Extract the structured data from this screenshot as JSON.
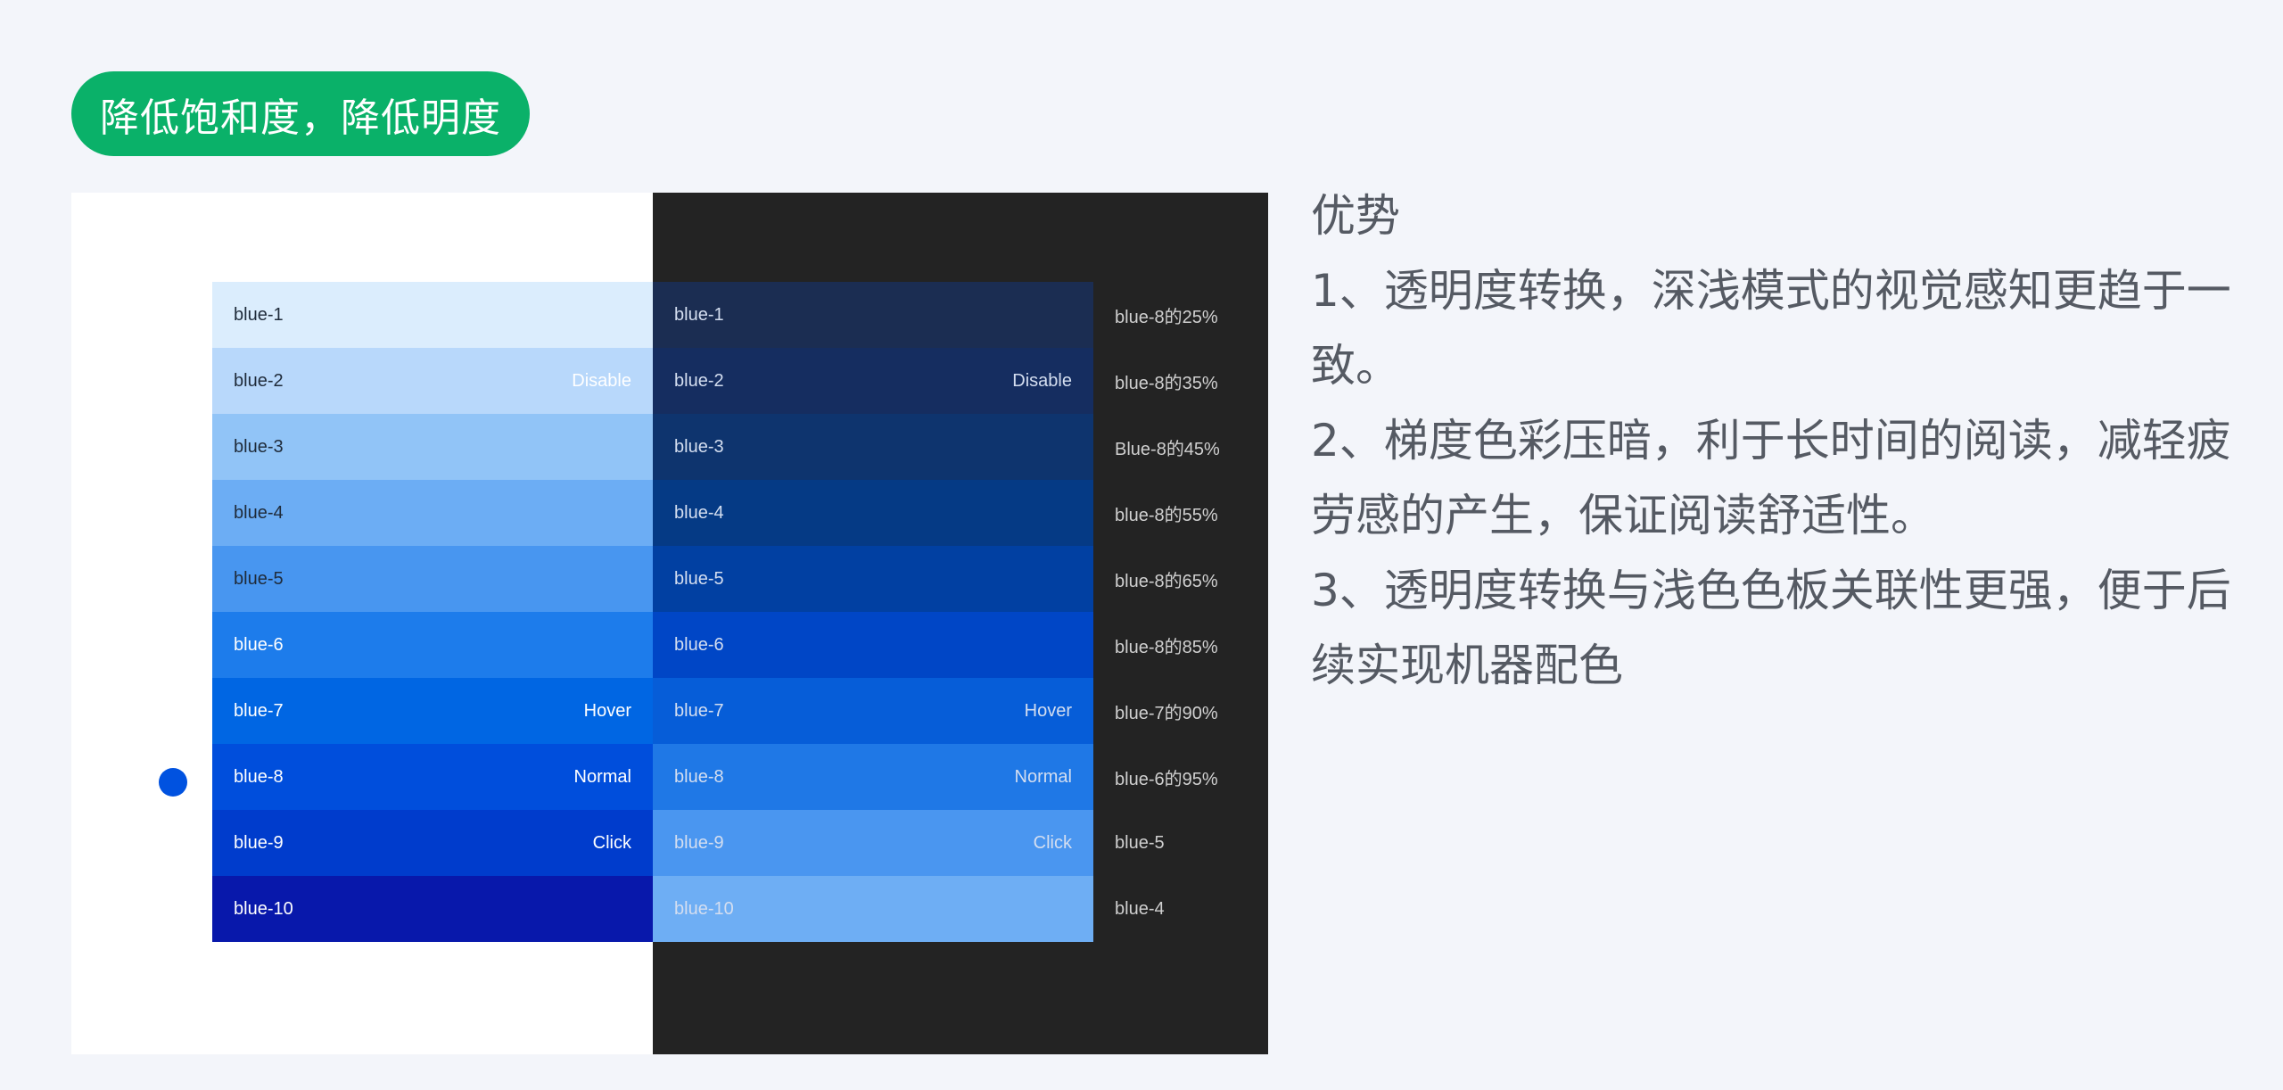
{
  "header": {
    "badge": "降低饱和度，降低明度"
  },
  "colors": {
    "badge_bg": "#0ab169",
    "badge_text": "#ffffff",
    "light_panel_bg": "#ffffff",
    "dark_panel_bg": "#232323",
    "marker": "#0052e0",
    "light_text_dark": "#1f2b3a",
    "light_text_light": "#ffffff",
    "dark_text": "#d4def0",
    "note_text": "#d0d0d0"
  },
  "light_palette": [
    {
      "name": "blue-1",
      "state": "",
      "color": "#dbedfd",
      "text": "dark"
    },
    {
      "name": "blue-2",
      "state": "Disable",
      "color": "#b8d8fb",
      "text": "dark",
      "state_text": "light"
    },
    {
      "name": "blue-3",
      "state": "",
      "color": "#91c4f7",
      "text": "dark"
    },
    {
      "name": "blue-4",
      "state": "",
      "color": "#6cadf4",
      "text": "dark"
    },
    {
      "name": "blue-5",
      "state": "",
      "color": "#4896f0",
      "text": "dark"
    },
    {
      "name": "blue-6",
      "state": "",
      "color": "#1d7ceb",
      "text": "light"
    },
    {
      "name": "blue-7",
      "state": "Hover",
      "color": "#0066e3",
      "text": "light"
    },
    {
      "name": "blue-8",
      "state": "Normal",
      "color": "#004edc",
      "text": "light"
    },
    {
      "name": "blue-9",
      "state": "Click",
      "color": "#003ccc",
      "text": "light"
    },
    {
      "name": "blue-10",
      "state": "",
      "color": "#0818ab",
      "text": "light"
    }
  ],
  "dark_palette": [
    {
      "name": "blue-1",
      "state": "",
      "color": "#1b2d52"
    },
    {
      "name": "blue-2",
      "state": "Disable",
      "color": "#152d60"
    },
    {
      "name": "blue-3",
      "state": "",
      "color": "#0e346e"
    },
    {
      "name": "blue-4",
      "state": "",
      "color": "#053a85"
    },
    {
      "name": "blue-5",
      "state": "",
      "color": "#0140a2"
    },
    {
      "name": "blue-6",
      "state": "",
      "color": "#0046c6"
    },
    {
      "name": "blue-7",
      "state": "Hover",
      "color": "#065dd8"
    },
    {
      "name": "blue-8",
      "state": "Normal",
      "color": "#1f78e6"
    },
    {
      "name": "blue-9",
      "state": "Click",
      "color": "#4a96f0"
    },
    {
      "name": "blue-10",
      "state": "",
      "color": "#6eaef4"
    }
  ],
  "dark_notes": [
    "blue-8的25%",
    "blue-8的35%",
    "Blue-8的45%",
    "blue-8的55%",
    "blue-8的65%",
    "blue-8的85%",
    "blue-7的90%",
    "blue-6的95%",
    "blue-5",
    "blue-4"
  ],
  "advantages": {
    "title": "优势",
    "points": [
      "1、透明度转换，深浅模式的视觉感知更趋于一致。",
      "2、梯度色彩压暗，利于长时间的阅读，减轻疲劳感的产生，保证阅读舒适性。",
      "3、透明度转换与浅色色板关联性更强，便于后续实现机器配色"
    ]
  }
}
